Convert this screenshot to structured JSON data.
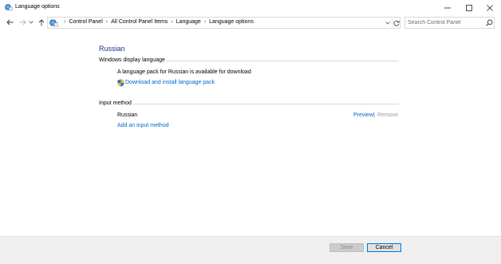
{
  "window": {
    "title": "Language options",
    "controls": {
      "minimize": "minimize-icon",
      "maximize": "maximize-icon",
      "close": "close-icon"
    }
  },
  "address": {
    "crumbs": [
      "Control Panel",
      "All Control Panel Items",
      "Language",
      "Language options"
    ]
  },
  "search": {
    "placeholder": "Search Control Panel"
  },
  "content": {
    "heading": "Russian",
    "display_section": {
      "label": "Windows display language",
      "message": "A language pack for Russian is available for download",
      "link": "Download and install language pack"
    },
    "input_section": {
      "label": "Input method",
      "method_name": "Russian",
      "preview": "Preview",
      "separator": "|",
      "remove": "Remove",
      "add_link": "Add an input method"
    }
  },
  "footer": {
    "save": "Save",
    "cancel": "Cancel"
  },
  "colors": {
    "link": "#0066cc",
    "heading": "#1e3287",
    "accent": "#0078d7"
  }
}
